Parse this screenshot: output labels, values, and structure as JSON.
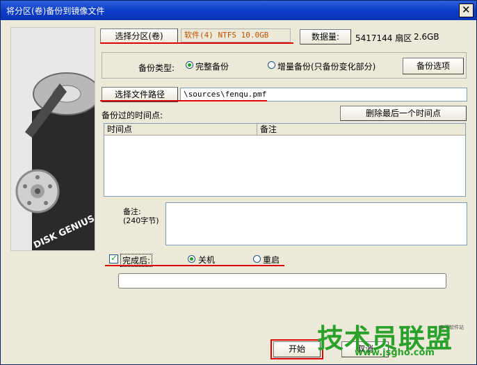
{
  "window": {
    "title": "将分区(卷)备份到镜像文件"
  },
  "partition": {
    "select_button": "选择分区(卷)",
    "selected_text": "软件(4) NTFS 10.0GB",
    "data_size_button": "数据量:",
    "sector_count": "5417144 扇区",
    "size": "2.6GB"
  },
  "backup_type": {
    "label": "备份类型:",
    "option_full": "完整备份",
    "option_incremental": "增量备份(只备份变化部分)",
    "options_button": "备份选项",
    "selected": "完整备份"
  },
  "file_path": {
    "select_button": "选择文件路径",
    "value": "\\sources\\fenqu.pmf"
  },
  "timepoints": {
    "label": "备份过的时间点:",
    "delete_button": "删除最后一个时间点",
    "columns": [
      "时间点",
      "备注"
    ],
    "rows": []
  },
  "notes": {
    "label_line1": "备注:",
    "label_line2": "(240字节)",
    "value": ""
  },
  "after_completion": {
    "checkbox_label": "完成后:",
    "checked": true,
    "option_shutdown": "关机",
    "option_restart": "重启",
    "selected": "关机"
  },
  "progress": {
    "value": 0
  },
  "footer": {
    "start_button": "开始",
    "cancel_button": "取消"
  },
  "watermark": {
    "main": "技术员联盟",
    "url": "www.jsgho.com",
    "sub": "安下软件站"
  },
  "colors": {
    "title_bar": "#0b3cc7",
    "annotation_red": "#e00000",
    "partition_text": "#c05000",
    "watermark_green": "#2aa12a"
  },
  "side_image": {
    "brand_text": "DISK GENIUS"
  }
}
